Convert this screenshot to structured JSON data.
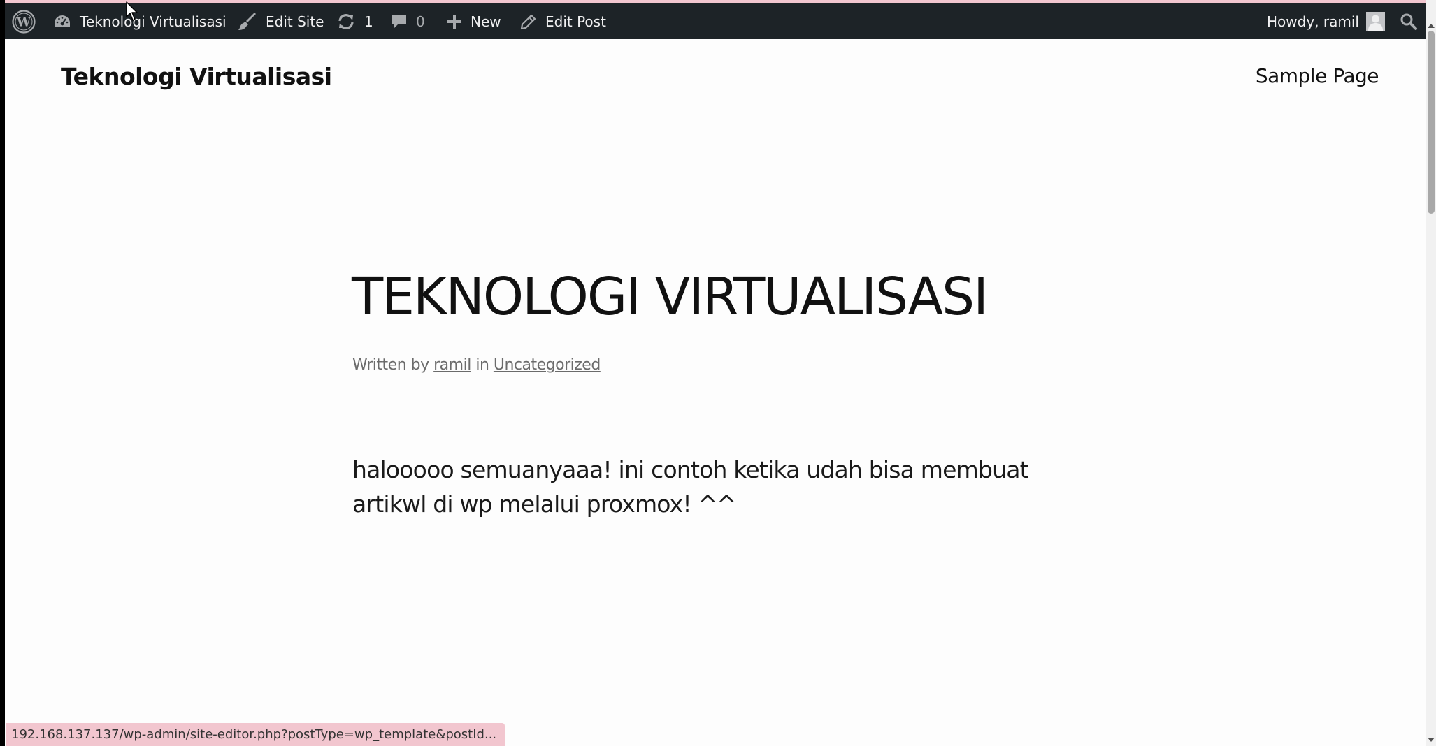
{
  "adminbar": {
    "wp_logo_icon": "wordpress-icon",
    "site_name": "Teknologi Virtualisasi",
    "site_icon": "dashboard-icon",
    "edit_site_label": "Edit Site",
    "edit_site_icon": "brush-icon",
    "updates_count": "1",
    "updates_icon": "refresh-icon",
    "comments_count": "0",
    "comments_icon": "comment-icon",
    "new_label": "New",
    "new_icon": "plus-icon",
    "edit_post_label": "Edit Post",
    "edit_post_icon": "pencil-icon",
    "greeting": "Howdy, ramil",
    "avatar_icon": "avatar-icon",
    "search_icon": "search-icon",
    "bg_color": "#1d2327"
  },
  "header": {
    "site_title": "Teknologi Virtualisasi",
    "nav": [
      "Sample Page"
    ]
  },
  "post": {
    "title": "TEKNOLOGI VIRTUALISASI",
    "meta_written_by": "Written by",
    "author": "ramil",
    "meta_in": "in",
    "category": "Uncategorized",
    "content": "halooooo semuanyaaa! ini contoh ketika udah bisa membuat artikwl di wp melalui proxmox! ^^"
  },
  "status_bar": {
    "url": "192.168.137.137/wp-admin/site-editor.php?postType=wp_template&postId..."
  },
  "colors": {
    "accent_pink": "#f2c6cf",
    "text": "#111111",
    "meta": "#6b6b6b"
  }
}
